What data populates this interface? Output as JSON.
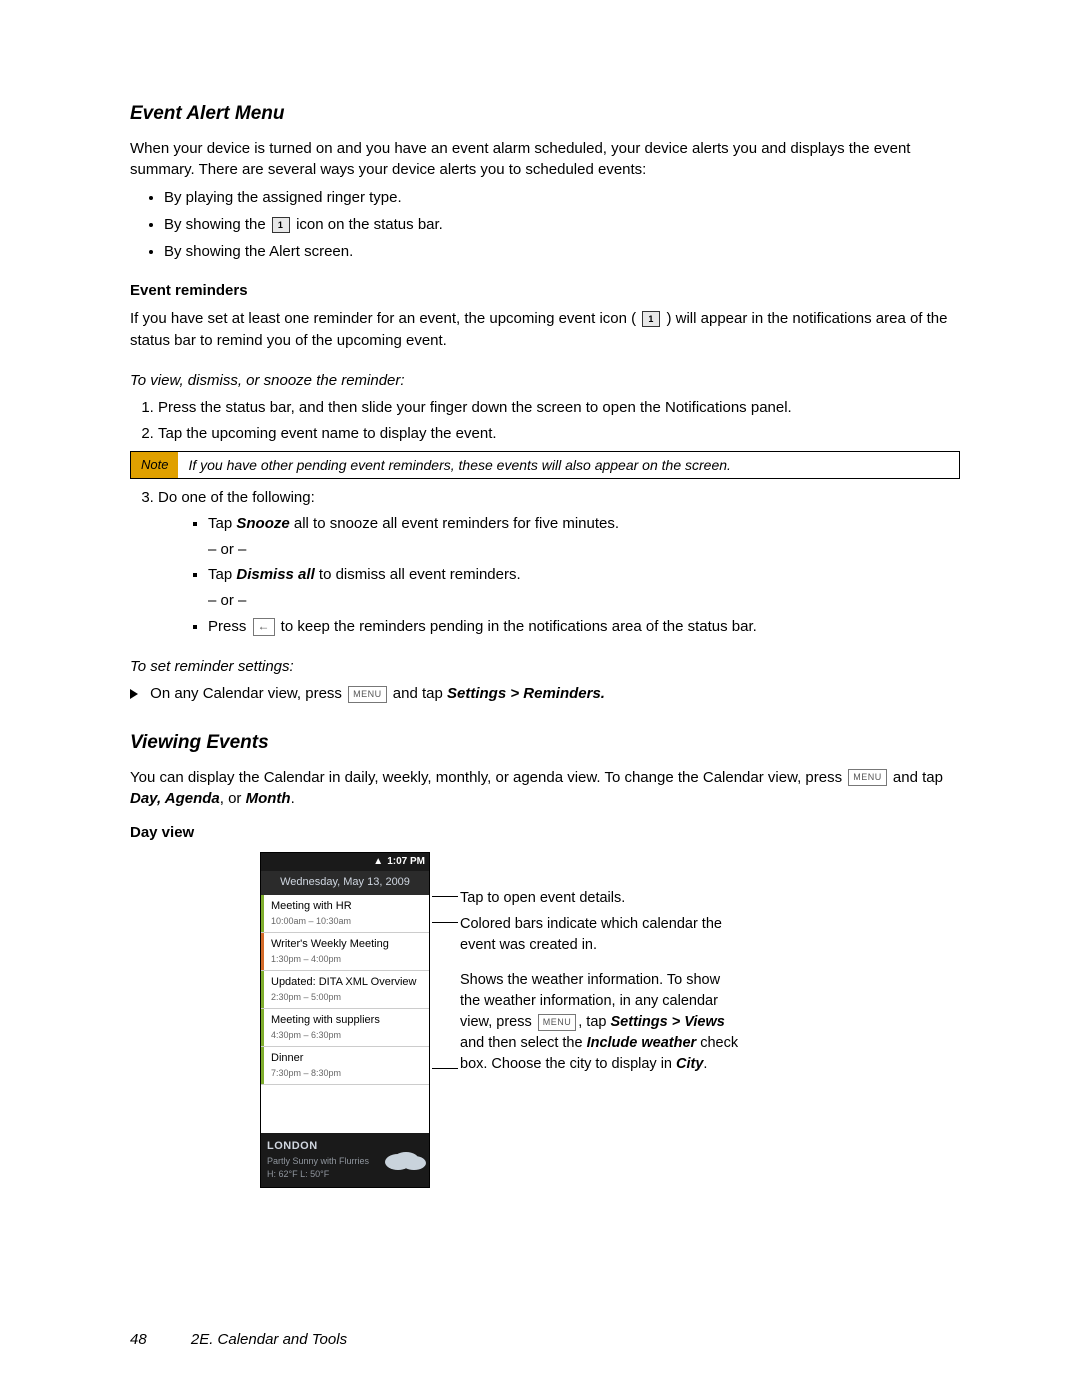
{
  "section1": {
    "title": "Event Alert Menu",
    "intro": "When your device is turned on and you have an event alarm scheduled, your device alerts you and displays the event summary. There are several ways your device alerts you to scheduled events:",
    "bullets": [
      "By playing the assigned ringer type.",
      "By showing the",
      "icon on the status bar.",
      "By showing the Alert screen."
    ],
    "reminders_heading": "Event reminders",
    "reminders_text_a": "If you have set at least one reminder for an event, the upcoming event icon (",
    "reminders_text_b": ") will appear in the notifications area of the status bar to remind you of the upcoming event.",
    "task1_heading": "To view, dismiss, or snooze the reminder:",
    "step1": "Press the status bar, and then slide your finger down the screen to open the Notifications panel.",
    "step2": "Tap the upcoming event name to display the event.",
    "note_label": "Note",
    "note_text": "If you have other pending event reminders, these events will also appear on the screen.",
    "step3_lead": "Do one of the following:",
    "s3_a_pre": "Tap ",
    "s3_a_key": "Snooze",
    "s3_a_post": " all to snooze all event reminders for five minutes.",
    "or": "– or –",
    "s3_b_pre": "Tap ",
    "s3_b_key": "Dismiss all",
    "s3_b_post": " to dismiss all event reminders.",
    "s3_c_pre": "Press ",
    "s3_c_post": " to keep the reminders pending in the notifications area of the status bar.",
    "task2_heading": "To set reminder settings:",
    "task2_a": "On any Calendar view, press ",
    "task2_b": " and tap ",
    "task2_path": "Settings > Reminders."
  },
  "section2": {
    "title": "Viewing Events",
    "intro_a": "You can display the Calendar in daily, weekly, monthly, or agenda view. To change the Calendar view, press ",
    "intro_b": " and tap ",
    "intro_opts": "Day, Agenda",
    "intro_c": ", or ",
    "intro_last": "Month",
    "intro_d": ".",
    "dayview_heading": "Day view",
    "phone": {
      "time": "1:07 PM",
      "date": "Wednesday, May 13, 2009",
      "events": [
        {
          "title": "Meeting with HR",
          "time": "10:00am – 10:30am",
          "bar": "#7fae2e"
        },
        {
          "title": "Writer's Weekly Meeting",
          "time": "1:30pm – 4:00pm",
          "bar": "#d36b2a"
        },
        {
          "title": "Updated: DITA XML Overview",
          "time": "2:30pm – 5:00pm",
          "bar": "#7fae2e"
        },
        {
          "title": "Meeting with suppliers",
          "time": "4:30pm – 6:30pm",
          "bar": "#7fae2e"
        },
        {
          "title": "Dinner",
          "time": "7:30pm – 8:30pm",
          "bar": "#7fae2e"
        }
      ],
      "weather": {
        "city": "LONDON",
        "cond": "Partly Sunny with Flurries",
        "hl": "H: 62°F   L: 50°F"
      }
    },
    "callouts": {
      "c1": "Tap to open event details.",
      "c2": "Colored bars indicate which calendar the event was created in.",
      "c3a": "Shows the weather information. To show the weather information, in any calendar view, press ",
      "c3b": ", tap ",
      "c3path": "Settings > Views",
      "c3c": " and then select the ",
      "c3key": "Include weather",
      "c3d": " check box. Choose the city to display in ",
      "c3city": "City",
      "c3e": "."
    }
  },
  "footer": {
    "page": "48",
    "chapter": "2E. Calendar and Tools"
  }
}
